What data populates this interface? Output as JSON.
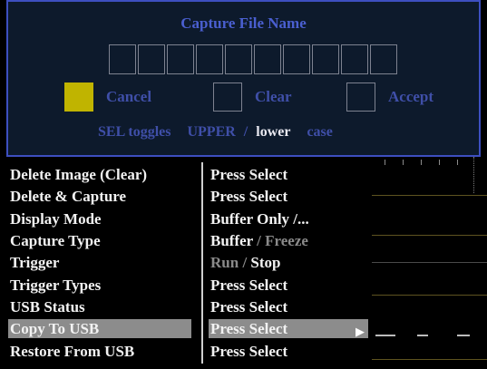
{
  "dialog": {
    "title": "Capture File Name",
    "char_slot_count": 10,
    "buttons": {
      "cancel": "Cancel",
      "clear": "Clear",
      "accept": "Accept"
    },
    "case_toggle": {
      "prefix": "SEL toggles",
      "upper": "UPPER",
      "sep": "/",
      "lower": "lower",
      "suffix": "case"
    }
  },
  "menu": {
    "items": [
      {
        "label": "Delete Image (Clear)",
        "value": "Press Select"
      },
      {
        "label": "Delete & Capture",
        "value": "Press Select"
      },
      {
        "label": "Display Mode",
        "value": "Buffer Only /..."
      },
      {
        "label": "Capture Type",
        "value_active": "Buffer",
        "value_sep": "/",
        "value_inactive": "Freeze"
      },
      {
        "label": "Trigger",
        "value_inactive": "Run",
        "value_sep": "/",
        "value_active": "Stop"
      },
      {
        "label": "Trigger Types",
        "value": "Press Select"
      },
      {
        "label": "USB Status",
        "value": "Press Select"
      },
      {
        "label": "Copy To USB",
        "value": "Press Select",
        "selected": true,
        "submenu_icon": "right-arrow-icon"
      },
      {
        "label": "Restore From USB",
        "value": "Press Select"
      }
    ]
  },
  "colors": {
    "dialog_border": "#3d4fc0",
    "dialog_bg": "#0d1a2c",
    "selected_button": "#c0b400",
    "menu_highlight": "#8c8c8c",
    "dim_text": "#8a8a8a"
  }
}
